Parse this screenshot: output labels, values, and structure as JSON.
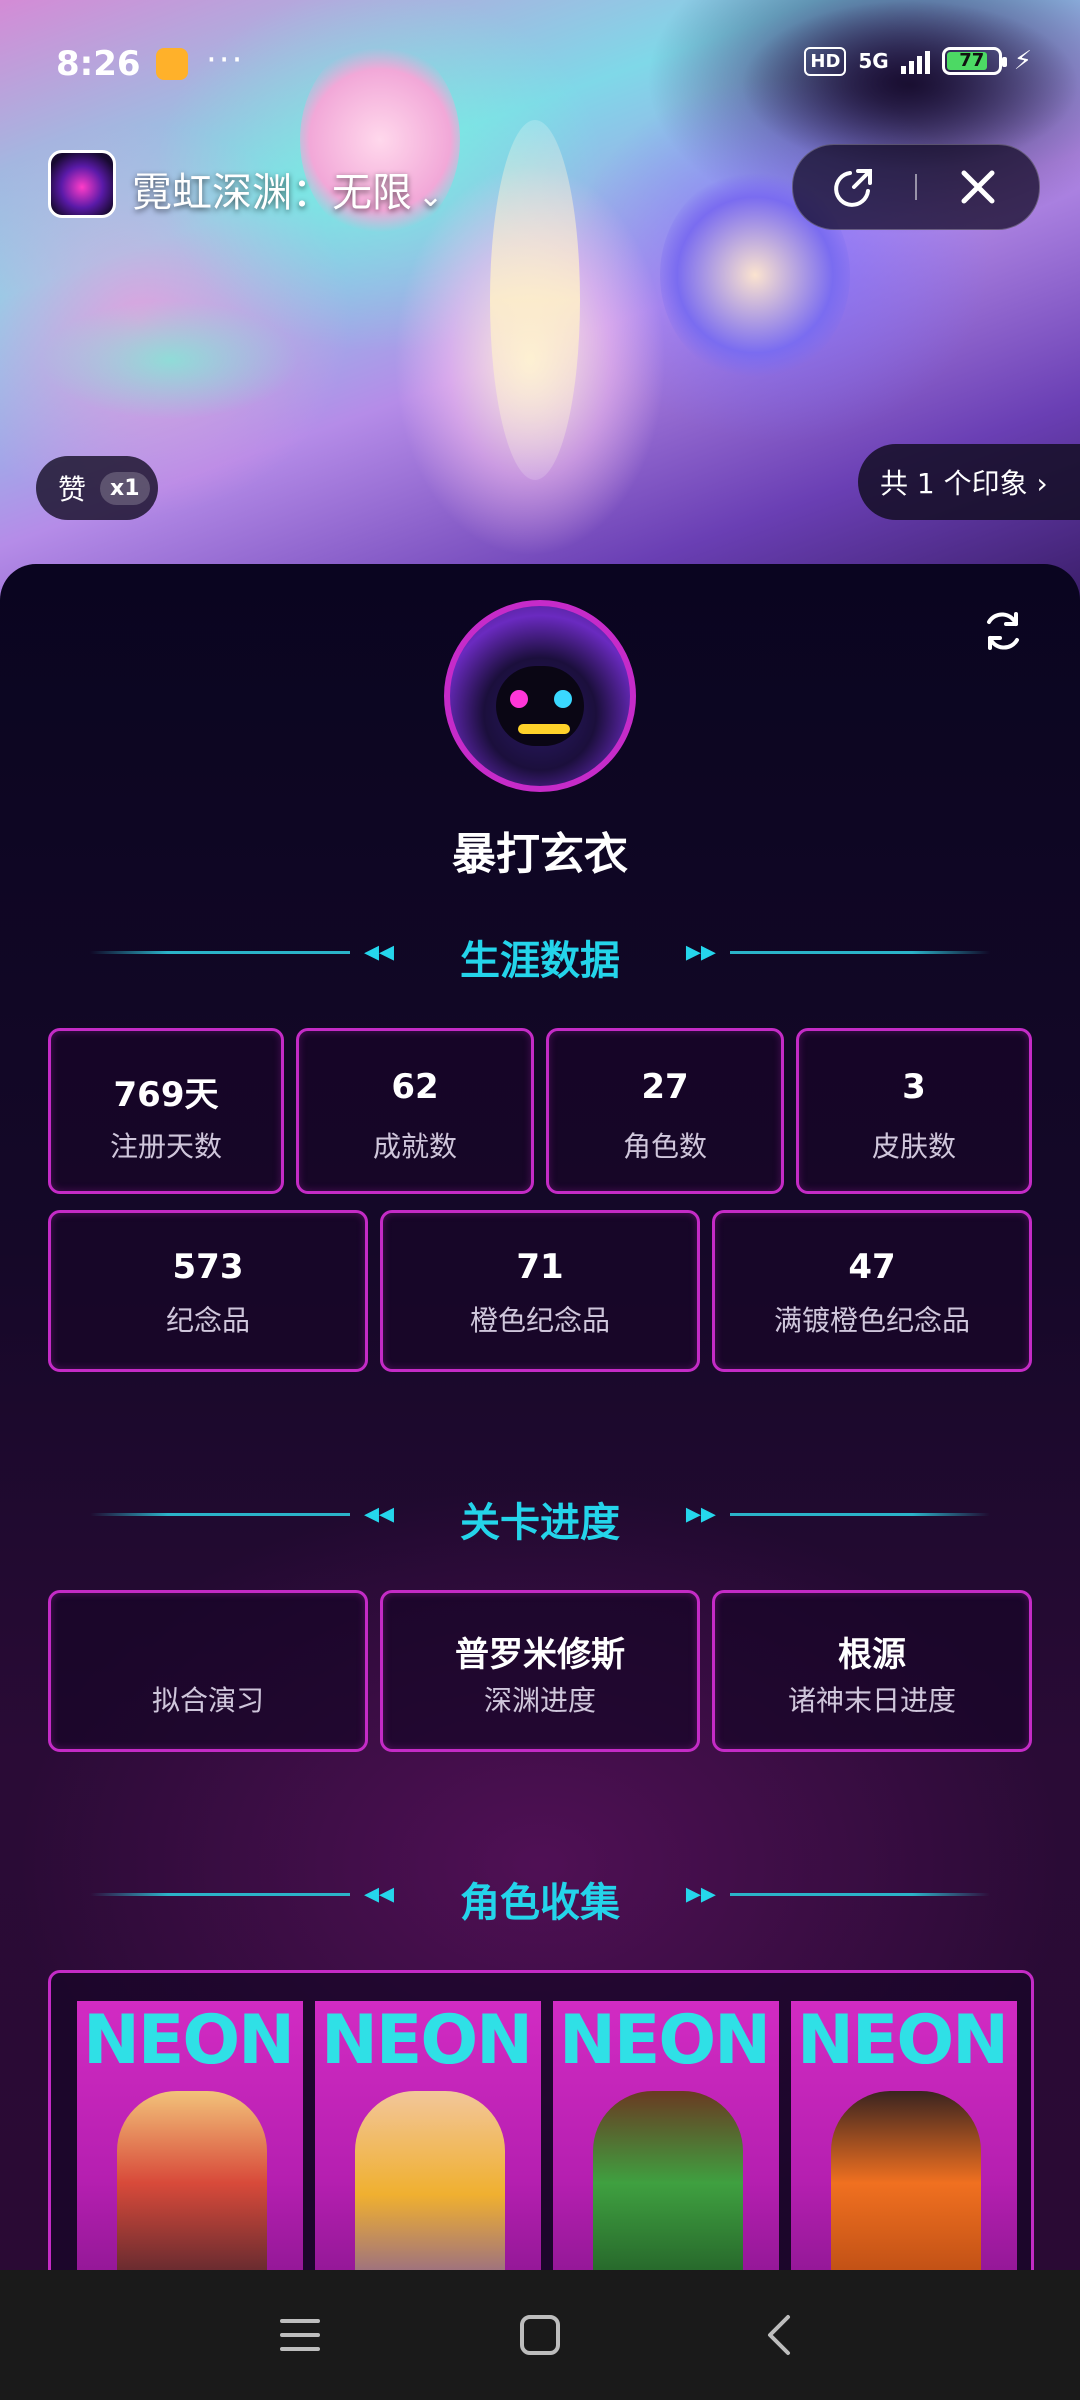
{
  "status_bar": {
    "time": "8:26",
    "more": "···",
    "hd": "HD",
    "network": "5G",
    "battery": "77"
  },
  "mini_app": {
    "title": "霓虹深渊：无限",
    "chevron": "⌄"
  },
  "hero": {
    "like_label": "赞",
    "like_count": "x1",
    "impressions": "共 1 个印象 ›"
  },
  "profile": {
    "username": "暴打玄衣"
  },
  "career": {
    "title": "生涯数据",
    "row1": [
      {
        "value": "769天",
        "label": "注册天数"
      },
      {
        "value": "62",
        "label": "成就数"
      },
      {
        "value": "27",
        "label": "角色数"
      },
      {
        "value": "3",
        "label": "皮肤数"
      }
    ],
    "row2": [
      {
        "value": "573",
        "label": "纪念品"
      },
      {
        "value": "71",
        "label": "橙色纪念品"
      },
      {
        "value": "47",
        "label": "满镀橙色纪念品"
      }
    ]
  },
  "levels": {
    "title": "关卡进度",
    "items": [
      {
        "value": "",
        "label": "拟合演习"
      },
      {
        "value": "普罗米修斯",
        "label": "深渊进度"
      },
      {
        "value": "根源",
        "label": "诸神末日进度"
      }
    ]
  },
  "collection": {
    "title": "角色收集",
    "card_text": "NEON",
    "characters": [
      {
        "icon": "gunner-character",
        "color": "#d84a3a"
      },
      {
        "icon": "rifle-girl-character",
        "color": "#f0b030"
      },
      {
        "icon": "green-brawler-character",
        "color": "#3fa040"
      },
      {
        "icon": "orange-fighter-character",
        "color": "#f07020"
      }
    ]
  },
  "section_decor": {
    "left": "◂◂",
    "right": "▸▸"
  },
  "colors": {
    "accent_cyan": "#24d4ea",
    "accent_magenta": "#c42bc6",
    "background": "#0c0618"
  }
}
